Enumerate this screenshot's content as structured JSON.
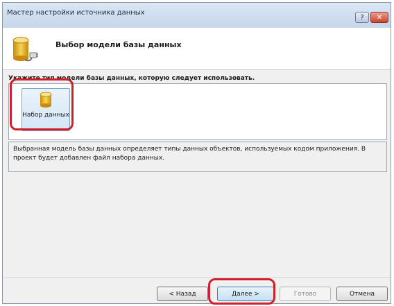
{
  "window": {
    "title": "Мастер настройки источника данных"
  },
  "titlebar": {
    "help_label": "?",
    "close_label": "✕"
  },
  "header": {
    "title": "Выбор модели базы данных",
    "icon": "database-plug-icon"
  },
  "prompt": "Укажите тип модели базы данных, которую следует использовать.",
  "models": [
    {
      "label": "Набор данных",
      "icon": "database-icon",
      "selected": true
    }
  ],
  "description": "Выбранная модель базы данных определяет типы данных объектов, используемых кодом приложения. В проект будет добавлен файл набора данных.",
  "buttons": {
    "back": "< Назад",
    "next": "Далее >",
    "finish": "Готово",
    "cancel": "Отмена"
  },
  "colors": {
    "highlight": "#cf1f2b",
    "database_gold": "#e8b01c"
  }
}
